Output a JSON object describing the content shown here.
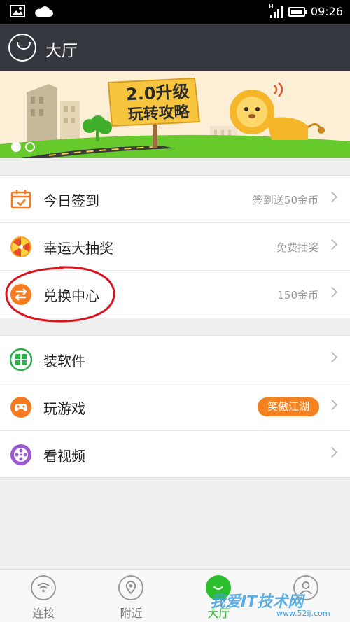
{
  "status_bar": {
    "time": "09:26",
    "network_badge": "H",
    "left_icons": [
      "image-icon",
      "cloud-icon"
    ]
  },
  "header": {
    "title": "大厅"
  },
  "banner": {
    "headline_line1": "2.0升级",
    "headline_line2": "玩转攻略",
    "pager_dots": 2,
    "active_dot": 1
  },
  "menu_group_1": [
    {
      "label": "今日签到",
      "meta": "签到送50金币",
      "icon": "calendar-icon",
      "color": "#f47b20"
    },
    {
      "label": "幸运大抽奖",
      "meta": "免费抽奖",
      "icon": "lottery-wheel-icon",
      "color": "#f7a21b"
    },
    {
      "label": "兑换中心",
      "meta": "150金币",
      "icon": "exchange-icon",
      "color": "#f47b20"
    }
  ],
  "menu_group_2": [
    {
      "label": "装软件",
      "meta": "",
      "icon": "apps-grid-icon",
      "color": "#2bb24c"
    },
    {
      "label": "玩游戏",
      "badge": "笑傲江湖",
      "icon": "gamepad-icon",
      "color": "#f47b20"
    },
    {
      "label": "看视频",
      "meta": "",
      "icon": "film-reel-icon",
      "color": "#9b59d0"
    }
  ],
  "bottom_nav": [
    {
      "label": "连接",
      "icon": "wifi-icon",
      "active": false
    },
    {
      "label": "附近",
      "icon": "location-pin-icon",
      "active": false
    },
    {
      "label": "大厅",
      "icon": "lobby-icon",
      "active": true
    },
    {
      "label": "",
      "icon": "profile-icon",
      "active": false
    }
  ],
  "watermark": {
    "text": "我爱IT技术网",
    "sub": "www.52ij.com"
  },
  "colors": {
    "accent_green": "#2bbf2b",
    "title_bar": "#34373d",
    "badge_orange": "#f58220",
    "annotation_red": "#d8141e"
  }
}
